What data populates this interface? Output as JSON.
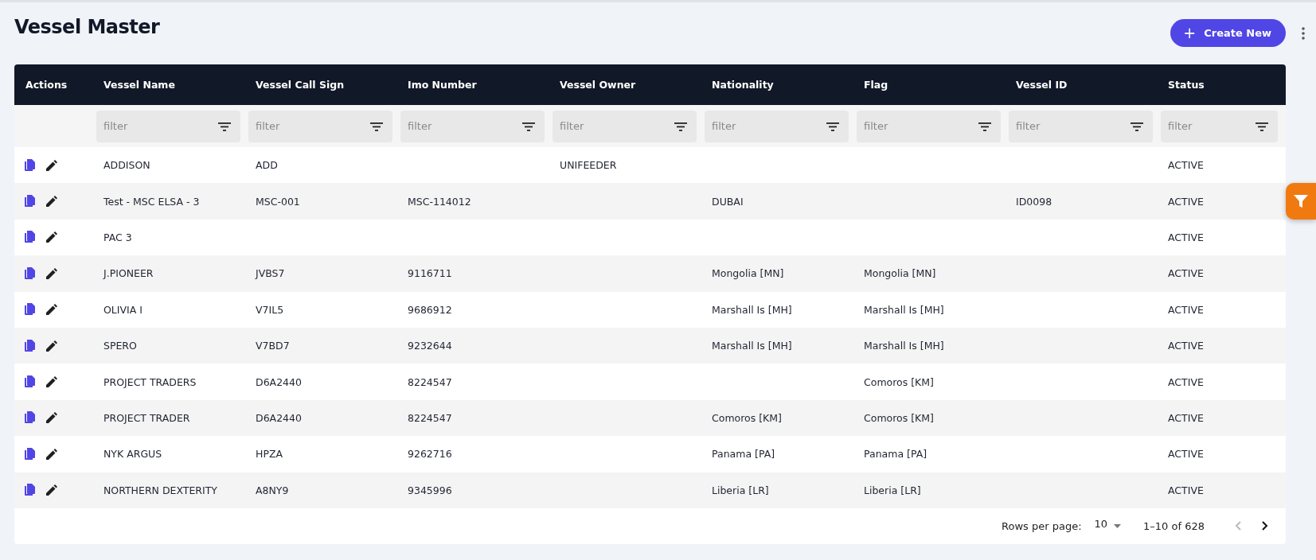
{
  "page": {
    "title": "Vessel Master"
  },
  "create_button": {
    "icon": "+",
    "label": "Create New"
  },
  "table": {
    "columns": [
      "Actions",
      "Vessel Name",
      "Vessel Call Sign",
      "Imo Number",
      "Vessel Owner",
      "Nationality",
      "Flag",
      "Vessel ID",
      "Status"
    ],
    "filters": [
      {
        "placeholder": "filter"
      },
      {
        "placeholder": "filter"
      },
      {
        "placeholder": "filter"
      },
      {
        "placeholder": "filter"
      },
      {
        "placeholder": "filter"
      },
      {
        "placeholder": "filter"
      },
      {
        "placeholder": "filter"
      },
      {
        "placeholder": "filter"
      }
    ],
    "rows": [
      {
        "cells": [
          "",
          "ADDISON",
          "ADD",
          "",
          "UNIFEEDER",
          "",
          "",
          "",
          "ACTIVE"
        ]
      },
      {
        "cells": [
          "",
          "Test - MSC ELSA - 3",
          "MSC-001",
          "MSC-114012",
          "",
          "DUBAI",
          "",
          "ID0098",
          "ACTIVE"
        ]
      },
      {
        "cells": [
          "",
          "PAC 3",
          "",
          "",
          "",
          "",
          "",
          "",
          "ACTIVE"
        ]
      },
      {
        "cells": [
          "",
          "J.PIONEER",
          "JVBS7",
          "9116711",
          "",
          "Mongolia [MN]",
          "Mongolia [MN]",
          "",
          "ACTIVE"
        ]
      },
      {
        "cells": [
          "",
          "OLIVIA I",
          "V7IL5",
          "9686912",
          "",
          "Marshall Is [MH]",
          "Marshall Is [MH]",
          "",
          "ACTIVE"
        ]
      },
      {
        "cells": [
          "",
          "SPERO",
          "V7BD7",
          "9232644",
          "",
          "Marshall Is [MH]",
          "Marshall Is [MH]",
          "",
          "ACTIVE"
        ]
      },
      {
        "cells": [
          "",
          "PROJECT TRADERS",
          "D6A2440",
          "8224547",
          "",
          "",
          "Comoros [KM]",
          "",
          "ACTIVE"
        ]
      },
      {
        "cells": [
          "",
          "PROJECT TRADER",
          "D6A2440",
          "8224547",
          "",
          "Comoros [KM]",
          "Comoros [KM]",
          "",
          "ACTIVE"
        ]
      },
      {
        "cells": [
          "",
          "NYK ARGUS",
          "HPZA",
          "9262716",
          "",
          "Panama [PA]",
          "Panama [PA]",
          "",
          "ACTIVE"
        ]
      },
      {
        "cells": [
          "",
          "NORTHERN DEXTERITY",
          "A8NY9",
          "9345996",
          "",
          "Liberia [LR]",
          "Liberia [LR]",
          "",
          "ACTIVE"
        ]
      }
    ]
  },
  "pagination": {
    "rows_per_page_label": "Rows per page:",
    "rows_per_page": "10",
    "range": "1–10 of 628",
    "previous": {
      "disabled": true
    },
    "next": {
      "disabled": false
    }
  }
}
